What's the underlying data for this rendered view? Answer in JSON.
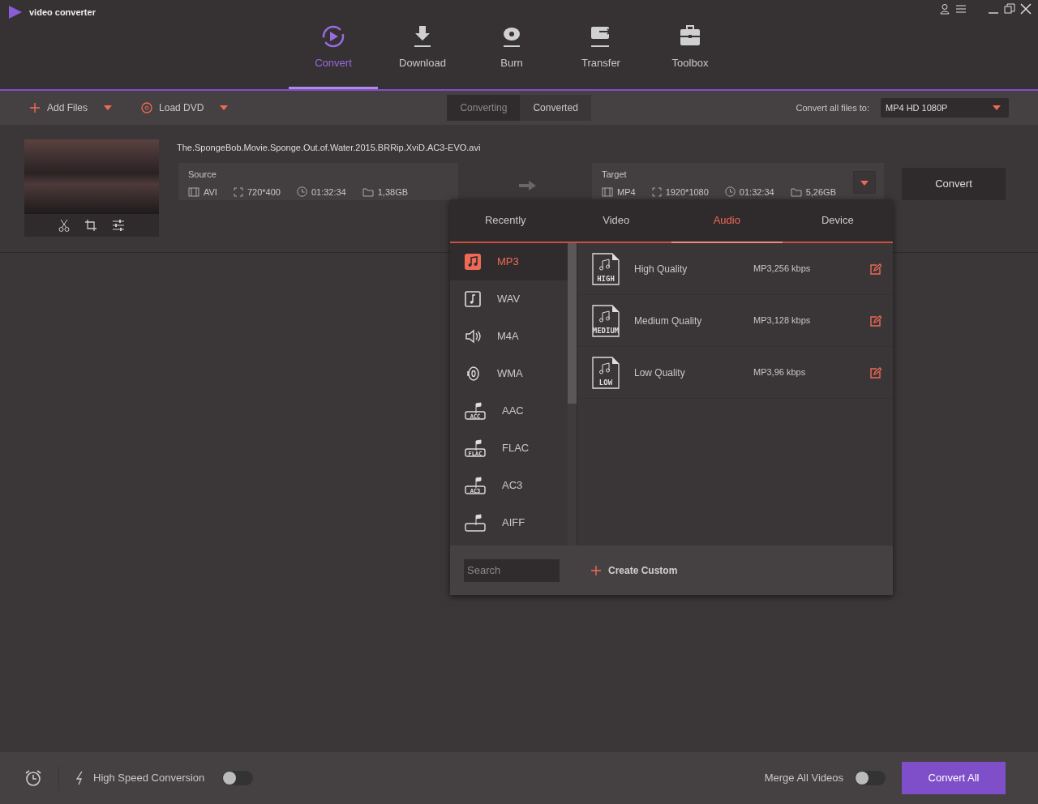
{
  "app": {
    "title": "video converter"
  },
  "nav": [
    {
      "label": "Convert",
      "selected": true
    },
    {
      "label": "Download",
      "selected": false
    },
    {
      "label": "Burn",
      "selected": false
    },
    {
      "label": "Transfer",
      "selected": false
    },
    {
      "label": "Toolbox",
      "selected": false
    }
  ],
  "toolbar": {
    "add_files": "Add Files",
    "load_dvd": "Load DVD",
    "view_tabs": [
      {
        "label": "Converting",
        "selected": true
      },
      {
        "label": "Converted",
        "selected": false
      }
    ],
    "convert_all_label": "Convert all files to:",
    "format_select": "MP4 HD 1080P"
  },
  "file": {
    "name": "The.SpongeBob.Movie.Sponge.Out.of.Water.2015.BRRip.XviD.AC3-EVO.avi",
    "source": {
      "title": "Source",
      "format": "AVI",
      "resolution": "720*400",
      "duration": "01:32:34",
      "size": "1,38GB"
    },
    "target": {
      "title": "Target",
      "format": "MP4",
      "resolution": "1920*1080",
      "duration": "01:32:34",
      "size": "5,26GB"
    },
    "convert_button": "Convert"
  },
  "popup": {
    "tabs": [
      {
        "label": "Recently",
        "selected": false
      },
      {
        "label": "Video",
        "selected": false
      },
      {
        "label": "Audio",
        "selected": true
      },
      {
        "label": "Device",
        "selected": false
      }
    ],
    "formats": [
      {
        "label": "MP3",
        "kind": "note",
        "selected": true
      },
      {
        "label": "WAV",
        "kind": "notebox",
        "selected": false
      },
      {
        "label": "M4A",
        "kind": "speaker",
        "selected": false
      },
      {
        "label": "WMA",
        "kind": "sound",
        "selected": false
      },
      {
        "label": "AAC",
        "kind": "tag",
        "icon_label": "ACC",
        "selected": false
      },
      {
        "label": "FLAC",
        "kind": "tag",
        "icon_label": "FLAC",
        "selected": false
      },
      {
        "label": "AC3",
        "kind": "tag",
        "icon_label": "AC3",
        "selected": false
      },
      {
        "label": "AIFF",
        "kind": "tag",
        "selected": false
      }
    ],
    "presets": [
      {
        "name": "High Quality",
        "detail": "MP3,256 kbps",
        "icon_label": "HIGH"
      },
      {
        "name": "Medium Quality",
        "detail": "MP3,128 kbps",
        "icon_label": "MEDIUM"
      },
      {
        "name": "Low Quality",
        "detail": "MP3,96 kbps",
        "icon_label": "LOW"
      }
    ],
    "search": {
      "placeholder": "Search"
    },
    "create_custom": "Create Custom"
  },
  "footer": {
    "high_speed": {
      "label": "High Speed Conversion",
      "on": false
    },
    "merge": {
      "label": "Merge All Videos",
      "on": false
    },
    "convert_all": "Convert All"
  }
}
